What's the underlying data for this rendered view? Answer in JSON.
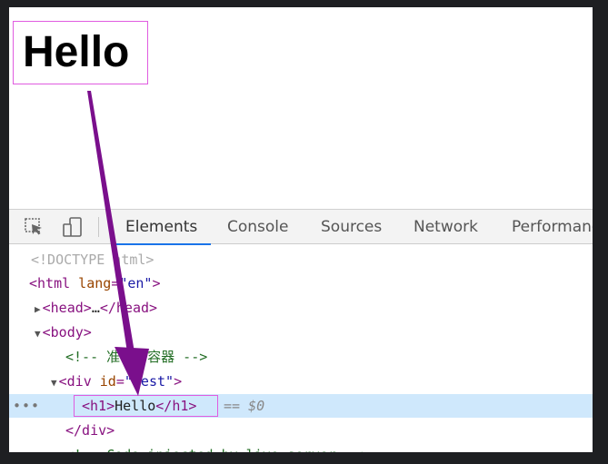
{
  "page": {
    "heading": "Hello"
  },
  "devtools": {
    "tabs": [
      "Elements",
      "Console",
      "Sources",
      "Network",
      "Performanc"
    ],
    "active_tab": "Elements",
    "icons": [
      "inspect-element-icon",
      "device-toolbar-icon"
    ],
    "tree": {
      "doctype": "<!DOCTYPE html>",
      "html_open": {
        "tag": "<html",
        "attr": " lang",
        "eq": "=",
        "val": "\"en\"",
        "close": ">"
      },
      "head": {
        "open": "<head>",
        "ellipsis": "…",
        "close": "</head>"
      },
      "body_open": "<body>",
      "comment_1": "<!-- 准备好容器 -->",
      "div_open": {
        "tag": "<div",
        "attr": " id",
        "eq": "=",
        "val": "\"test\"",
        "close": ">"
      },
      "h1": {
        "open": "<h1>",
        "text": "Hello",
        "close": "</h1>",
        "marker": "== $0",
        "dots": "•••"
      },
      "div_close": "</div>",
      "comment_2": "<!-- Code injected by live-server -->"
    }
  },
  "colors": {
    "highlight_border": "#e05ce0",
    "arrow": "#7a0f8c",
    "selected_row": "#cfe8fc",
    "active_tab_underline": "#1a73e8"
  }
}
